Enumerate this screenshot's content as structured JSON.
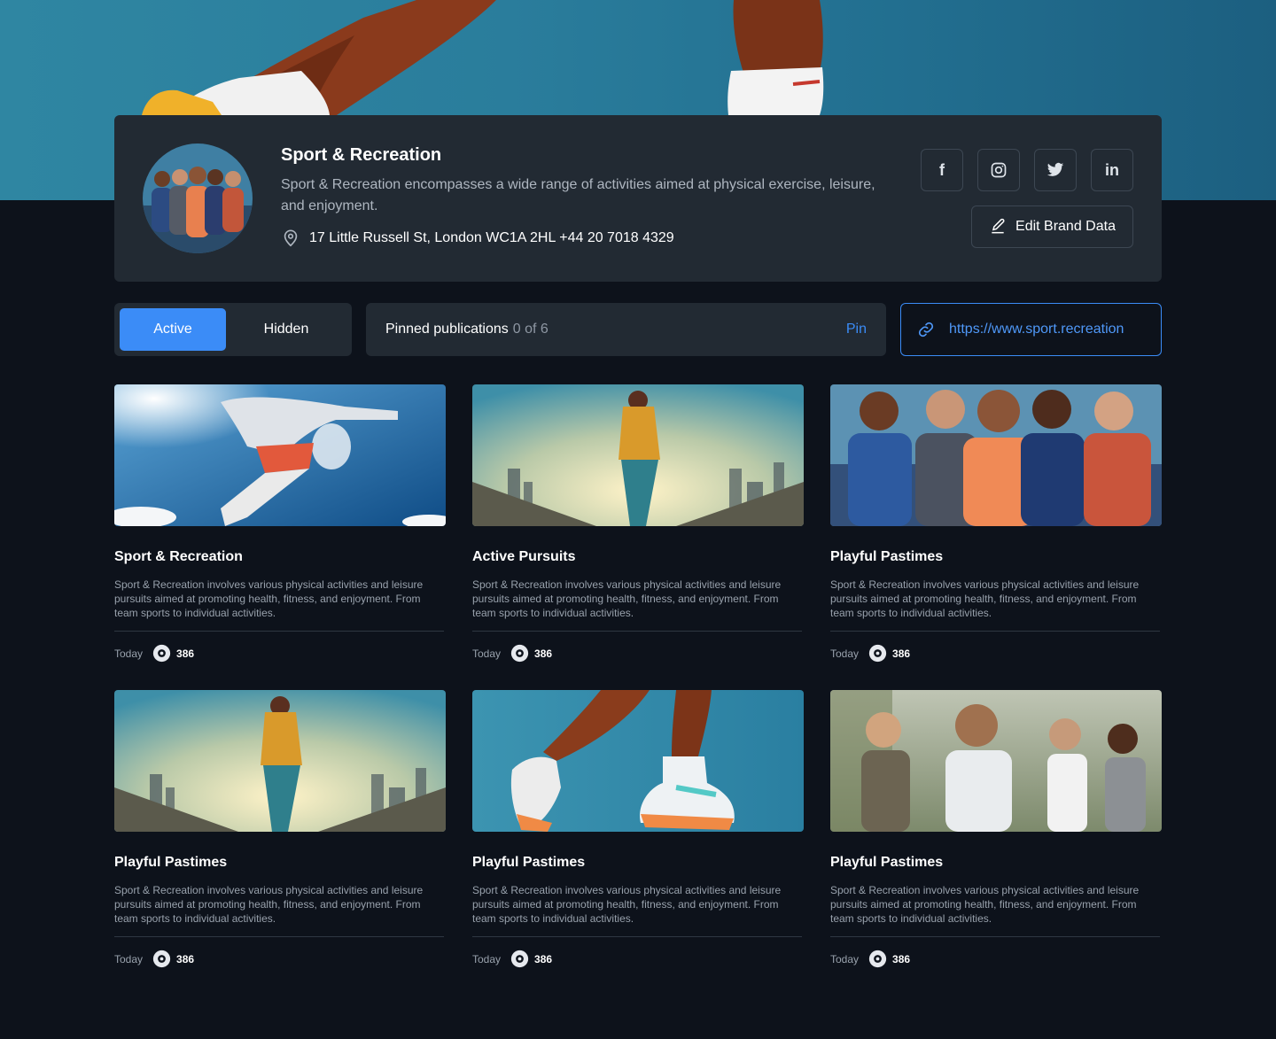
{
  "brand": {
    "name": "Sport & Recreation",
    "description": "Sport & Recreation encompasses a wide range of activities aimed at physical exercise, leisure, and enjoyment.",
    "address": "17 Little Russell St, London WC1A 2HL +44 20 7018 4329",
    "edit_label": "Edit Brand Data",
    "social": [
      {
        "name": "facebook-icon",
        "glyph": "f"
      },
      {
        "name": "instagram-icon",
        "glyph": ""
      },
      {
        "name": "twitter-icon",
        "glyph": ""
      },
      {
        "name": "linkedin-icon",
        "glyph": "in"
      }
    ]
  },
  "tabs": {
    "active_label": "Active",
    "hidden_label": "Hidden"
  },
  "pinned": {
    "label": "Pinned publications",
    "count": "0 of 6",
    "action": "Pin"
  },
  "url": "https://www.sport.recreation",
  "colors": {
    "accent": "#3b8cf7",
    "background": "#0d121b",
    "card": "#222a33"
  },
  "posts": [
    {
      "title": "Sport & Recreation",
      "description": "Sport & Recreation involves various physical activities and leisure pursuits aimed at promoting health, fitness, and enjoyment. From team sports to individual activities.",
      "date": "Today",
      "views": "386",
      "image": "jumper-sky"
    },
    {
      "title": "Active Pursuits",
      "description": "Sport & Recreation involves various physical activities and leisure pursuits aimed at promoting health, fitness, and enjoyment. From team sports to individual activities.",
      "date": "Today",
      "views": "386",
      "image": "runner-bridge"
    },
    {
      "title": "Playful Pastimes",
      "description": "Sport & Recreation involves various physical activities and leisure pursuits aimed at promoting health, fitness, and enjoyment. From team sports to individual activities.",
      "date": "Today",
      "views": "386",
      "image": "athletes-group"
    },
    {
      "title": "Playful Pastimes",
      "description": "Sport & Recreation involves various physical activities and leisure pursuits aimed at promoting health, fitness, and enjoyment. From team sports to individual activities.",
      "date": "Today",
      "views": "386",
      "image": "runner-bridge"
    },
    {
      "title": "Playful Pastimes",
      "description": "Sport & Recreation involves various physical activities and leisure pursuits aimed at promoting health, fitness, and enjoyment. From team sports to individual activities.",
      "date": "Today",
      "views": "386",
      "image": "runner-legs"
    },
    {
      "title": "Playful Pastimes",
      "description": "Sport & Recreation involves various physical activities and leisure pursuits aimed at promoting health, fitness, and enjoyment. From team sports to individual activities.",
      "date": "Today",
      "views": "386",
      "image": "group-running"
    }
  ]
}
